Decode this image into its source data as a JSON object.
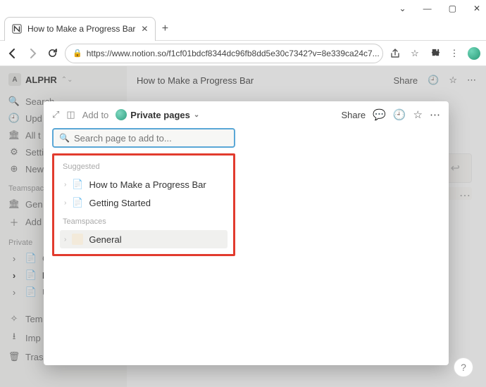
{
  "window": {
    "tab_title": "How to Make a Progress Bar"
  },
  "address_bar": {
    "url": "https://www.notion.so/f1cf01bdcf8344dc96fb8dd5e30c7342?v=8e339ca24c7..."
  },
  "sidebar": {
    "workspace_letter": "A",
    "workspace_name": "ALPHR",
    "items": {
      "search": "Search",
      "updates": "Upd",
      "alltea": "All t",
      "settings": "Setti",
      "newp": "New"
    },
    "section_teamspaces": "Teamspaces",
    "teamspaces": {
      "general": "Gen",
      "add": "Add"
    },
    "section_private": "Private",
    "private": {
      "ge": "Ge",
      "ho": "Ho",
      "un": "Un"
    },
    "footer": {
      "templates": "Tem",
      "import": "Imp",
      "trash": "Tras"
    }
  },
  "page_header": {
    "title": "How to Make a Progress Bar",
    "share": "Share"
  },
  "modal": {
    "addto_label": "Add to",
    "target_label": "Private pages",
    "share": "Share",
    "search_placeholder": "Search page to add to...",
    "suggested_label": "Suggested",
    "suggested": [
      {
        "label": "How to Make a Progress Bar"
      },
      {
        "label": "Getting Started"
      }
    ],
    "teamspaces_label": "Teamspaces",
    "teamspaces": [
      {
        "label": "General"
      }
    ]
  },
  "help": "?"
}
